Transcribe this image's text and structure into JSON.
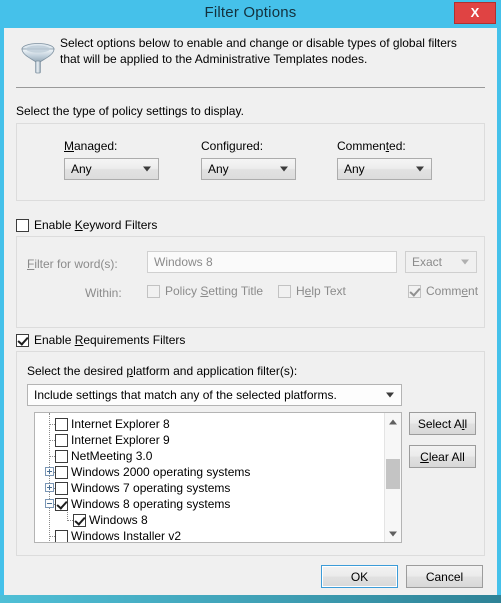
{
  "window": {
    "title": "Filter Options",
    "close_label": "X",
    "close_icon": "close-icon"
  },
  "header": {
    "icon": "funnel-icon",
    "description": "Select options below to enable and change or disable types of global filters that will be applied to the Administrative Templates nodes."
  },
  "policy_section": {
    "instruction": "Select the type of policy settings to display.",
    "fields": [
      {
        "label_prefix": "",
        "label_accel": "M",
        "label_suffix": "anaged:",
        "value": "Any"
      },
      {
        "label_prefix": "Confi",
        "label_accel": "g",
        "label_suffix": "ured:",
        "value": "Any"
      },
      {
        "label_prefix": "Commen",
        "label_accel": "t",
        "label_suffix": "ed:",
        "value": "Any"
      }
    ]
  },
  "keyword_section": {
    "enable_prefix": "Enable ",
    "enable_accel": "K",
    "enable_suffix": "eyword Filters",
    "enabled": false,
    "filter_label_prefix": "",
    "filter_label_accel": "F",
    "filter_label_suffix": "ilter for word(s):",
    "filter_value": "Windows 8",
    "match_mode": "Exact",
    "within_label": "Within:",
    "within_options": [
      {
        "prefix": "Policy ",
        "accel": "S",
        "suffix": "etting Title",
        "checked": false
      },
      {
        "prefix": "H",
        "accel": "e",
        "suffix": "lp Text",
        "checked": false
      },
      {
        "prefix": "Comm",
        "accel": "e",
        "suffix": "nt",
        "checked": true
      }
    ]
  },
  "requirements_section": {
    "enable_prefix": "Enable ",
    "enable_accel": "R",
    "enable_suffix": "equirements Filters",
    "enabled": true,
    "instruction_prefix": "Select the desired ",
    "instruction_accel": "p",
    "instruction_suffix": "latform and application filter(s):",
    "platform_mode": "Include settings that match any of the selected platforms.",
    "select_all_prefix": "Select A",
    "select_all_accel": "l",
    "select_all_suffix": "l",
    "clear_all_prefix": "",
    "clear_all_accel": "C",
    "clear_all_suffix": "lear All",
    "tree": [
      {
        "label": "Internet Explorer 8",
        "level": 0,
        "checked": false,
        "expander": "none"
      },
      {
        "label": "Internet Explorer 9",
        "level": 0,
        "checked": false,
        "expander": "none"
      },
      {
        "label": "NetMeeting 3.0",
        "level": 0,
        "checked": false,
        "expander": "none"
      },
      {
        "label": "Windows 2000 operating systems",
        "level": 0,
        "checked": false,
        "expander": "plus"
      },
      {
        "label": "Windows 7 operating systems",
        "level": 0,
        "checked": false,
        "expander": "plus"
      },
      {
        "label": "Windows 8 operating systems",
        "level": 0,
        "checked": true,
        "expander": "minus"
      },
      {
        "label": "Windows 8",
        "level": 1,
        "checked": true,
        "expander": "none"
      },
      {
        "label": "Windows Installer v2",
        "level": 0,
        "checked": false,
        "expander": "none"
      }
    ],
    "scrollbar": {
      "up_icon": "chevron-up-icon",
      "down_icon": "chevron-down-icon"
    }
  },
  "footer": {
    "ok_label": "OK",
    "cancel_label": "Cancel"
  },
  "colors": {
    "titlebar": "#45c1ea",
    "close_button": "#e04343",
    "client": "#f0f0f0",
    "default_button_border": "#3c9cd8"
  }
}
